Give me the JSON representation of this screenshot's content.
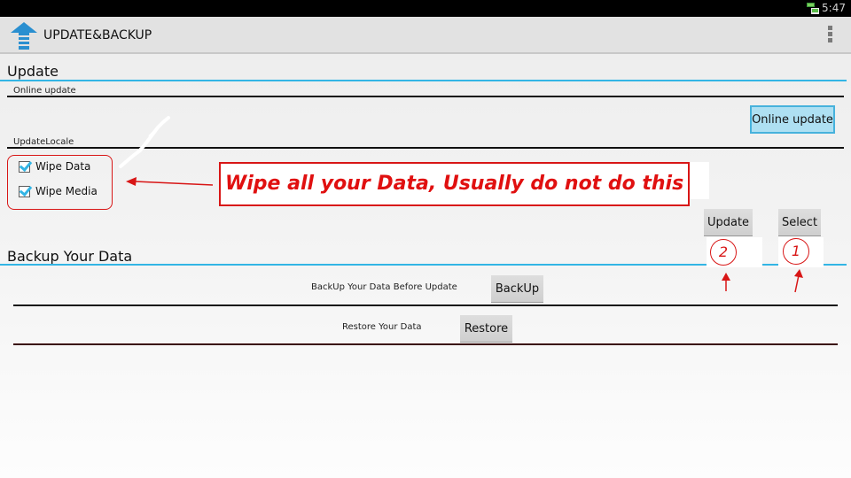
{
  "status_bar": {
    "time": "5:47",
    "icon": "screen-mirror-icon"
  },
  "action_bar": {
    "title": "UPDATE&BACKUP",
    "app_icon": "upload-arrow-icon",
    "menu_icon": "overflow-menu-icon"
  },
  "update_section": {
    "title": "Update",
    "online_update_label": "Online update",
    "online_update_button": "Online update",
    "update_locale_label": "UpdateLocale",
    "checkboxes": [
      {
        "label": "Wipe Data",
        "checked": true
      },
      {
        "label": "Wipe Media",
        "checked": true
      }
    ],
    "update_button": "Update",
    "select_button": "Select"
  },
  "backup_section": {
    "title": "Backup Your Data",
    "backup_text": "BackUp Your Data Before Update",
    "backup_button": "BackUp",
    "restore_text": "Restore Your Data",
    "restore_button": "Restore"
  },
  "annotations": {
    "callout": "Wipe all your Data, Usually do not do this",
    "step_select": "1",
    "step_update": "2",
    "color": "#d81616"
  },
  "colors": {
    "accent": "#33b5e5",
    "status_bar": "#000000",
    "action_bar": "#e2e2e2"
  }
}
